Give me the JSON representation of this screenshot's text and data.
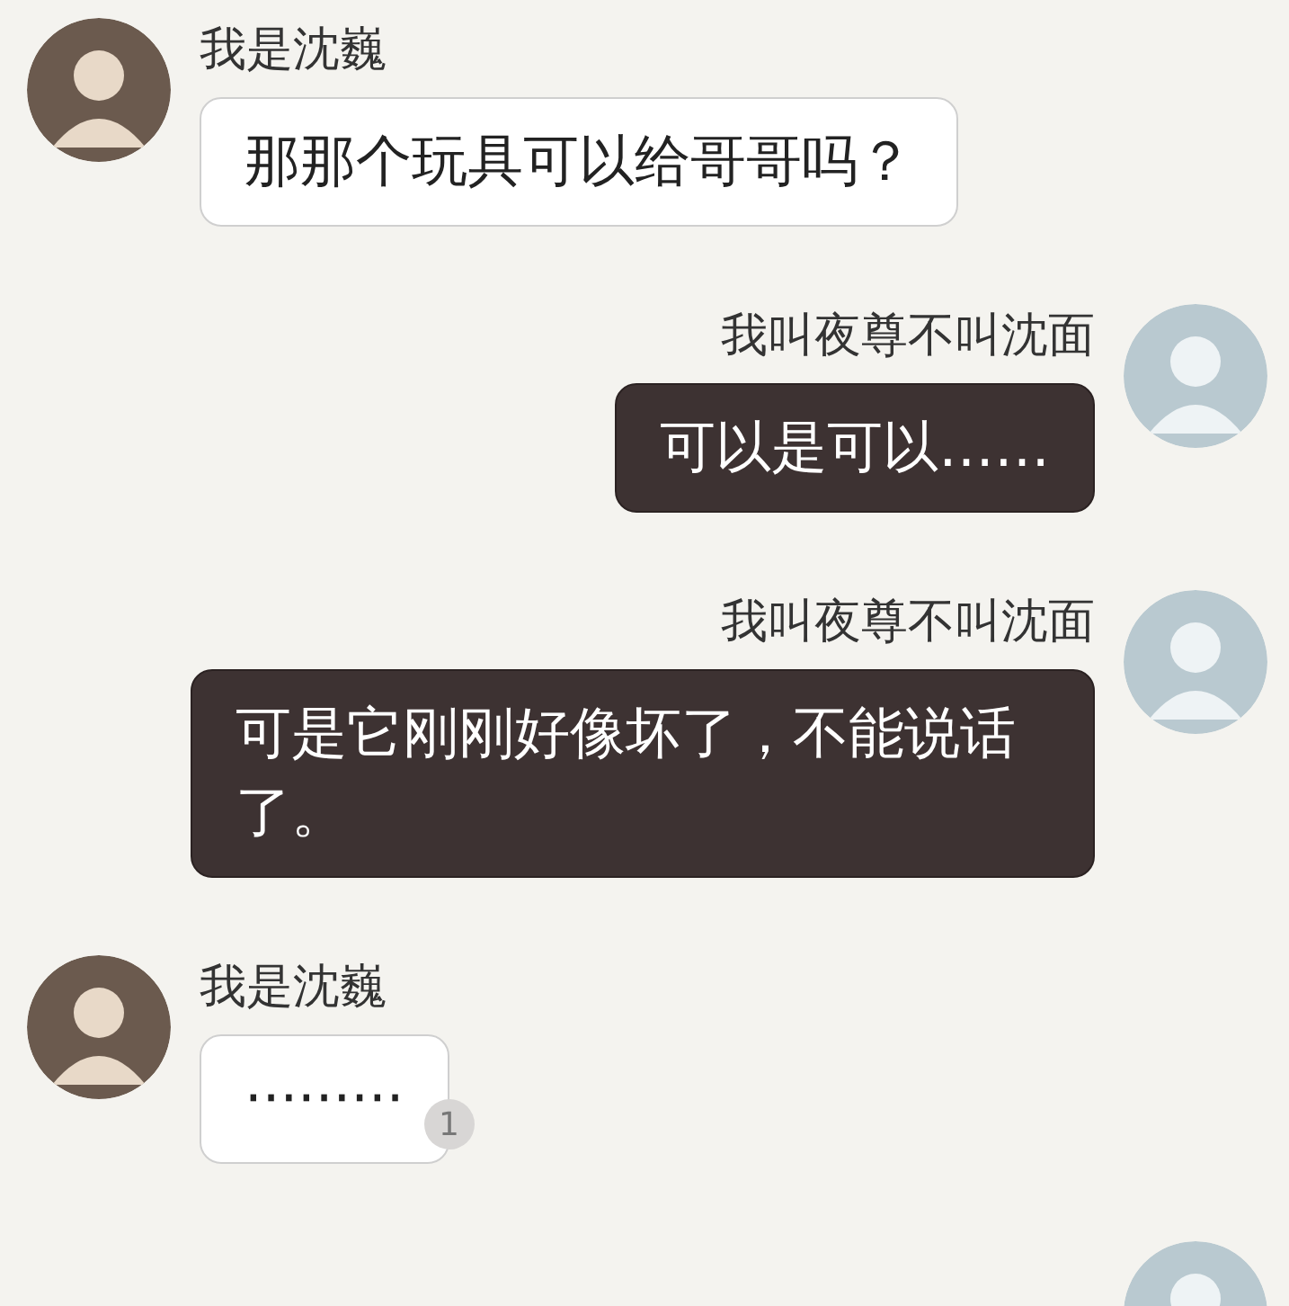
{
  "messages": [
    {
      "kind": "left",
      "sender": "我是沈巍",
      "text": "那那个玩具可以给哥哥吗？"
    },
    {
      "kind": "right",
      "sender": "我叫夜尊不叫沈面",
      "text": "可以是可以……"
    },
    {
      "kind": "right",
      "sender": "我叫夜尊不叫沈面",
      "text": "可是它刚刚好像坏了，不能说话了。"
    },
    {
      "kind": "left",
      "sender": "我是沈巍",
      "text": "·········",
      "badge": "1"
    }
  ],
  "more_below": true
}
